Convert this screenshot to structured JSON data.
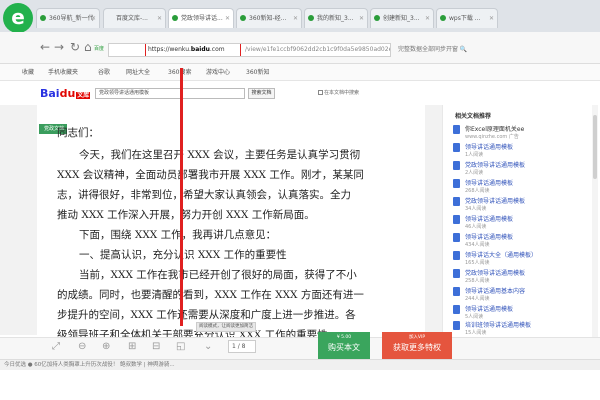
{
  "tabs": [
    {
      "label": "360导航_新一代",
      "x": "✕"
    },
    {
      "label": "百度文库-...",
      "x": "✕"
    },
    {
      "label": "党政领导讲话...",
      "x": "✕"
    },
    {
      "label": "360新知-经...",
      "x": "✕"
    },
    {
      "label": "我的新知_3...",
      "x": "✕"
    },
    {
      "label": "创建新知_3...",
      "x": "✕"
    },
    {
      "label": "wps下载 ...",
      "x": "✕"
    }
  ],
  "nav": {
    "back": "←",
    "forward": "→",
    "refresh": "↻",
    "home": "⌂",
    "badge": "百度"
  },
  "address": {
    "prefix": "https://wenku.",
    "domain": "baidu",
    "suffix": ".com",
    "rest": "/view/e1fe1ccbf9062dd2cb1c9f0da5e9850ad02e9ac"
  },
  "promo": "完整数据全部同步开窗 🔍",
  "bookmarks": [
    "收藏",
    "手机收藏夹",
    "谷歌",
    "网址大全",
    "360搜索",
    "游戏中心",
    "360新知"
  ],
  "docheader": {
    "logo_bai": "Bai",
    "logo_du": "du",
    "logo_wenku": "文库",
    "search_value": "党政领导讲话通用模板",
    "search_button": "搜索文档",
    "checkbox_label": "在本文档中搜索"
  },
  "tag": "党政文档",
  "doc_lines": [
    "同志们：",
    "今天，我们在这里召开 XXX 会议，主要任务是认真学习贯彻",
    "XXX 会议精神，全面动员部署我市开展 XXX 工作。刚才，某某同",
    "志，讲得很好，非常到位，希望大家认真领会，认真落实。全力",
    "推动 XXX 工作深入开展，努力开创 XXX 工作新局面。",
    "下面，围绕 XXX 工作，我再讲几点意见：",
    "一、提高认识，充分认识 XXX 工作的重要性",
    "当前，XXX 工作在我市已经开创了很好的局面，获得了不小",
    "的成绩。同时，也要清醒的看到，XXX 工作在 XXX 方面还有进一",
    "步提升的空间，XXX 工作还需要从深度和广度上进一步推进。各",
    "级领导班子和全体机关干部要充分认识 XXX 工作的重要性"
  ],
  "sidebar": {
    "title": "相关文档推荐",
    "items": [
      {
        "title": "你Excel原理面机关ee",
        "sub": "www.qinzhe.com   广告"
      },
      {
        "title": "领导讲话通用模板",
        "sub": "1人阅读"
      },
      {
        "title": "党政领导讲话通用模板",
        "sub": "2人阅读"
      },
      {
        "title": "领导讲话通用模板",
        "sub": "268人阅读"
      },
      {
        "title": "党政领导讲话通用模板",
        "sub": "34人阅读"
      },
      {
        "title": "领导讲话通用模板",
        "sub": "46人阅读"
      },
      {
        "title": "领导讲话通用模板",
        "sub": "434人阅读"
      },
      {
        "title": "领导讲话大全（通用模板）",
        "sub": "165人阅读"
      },
      {
        "title": "党政领导讲话通用模板",
        "sub": "258人阅读"
      },
      {
        "title": "领导讲话通用基本内容",
        "sub": "244人阅读"
      },
      {
        "title": "领导讲话通用模板",
        "sub": "5人阅读"
      },
      {
        "title": "培训班领导讲话通用模板",
        "sub": "15人阅读"
      }
    ]
  },
  "toolbar": {
    "icons": [
      "⤢",
      "⊖",
      "⊕",
      "⊞",
      "⊟",
      "◱",
      "⌄"
    ],
    "tip": "阅读模式，让阅读更加简洁",
    "page": "1 / 8"
  },
  "buttons": {
    "buy_small": "¥ 5.00",
    "buy_label": "购买本文",
    "vip_small": "加入VIP",
    "vip_label": "获取更多特权"
  },
  "status": "今日优选   ● 60亿加持人类胸罩上升历次战役！ 鲍叔数学 | 神舆游骑..."
}
